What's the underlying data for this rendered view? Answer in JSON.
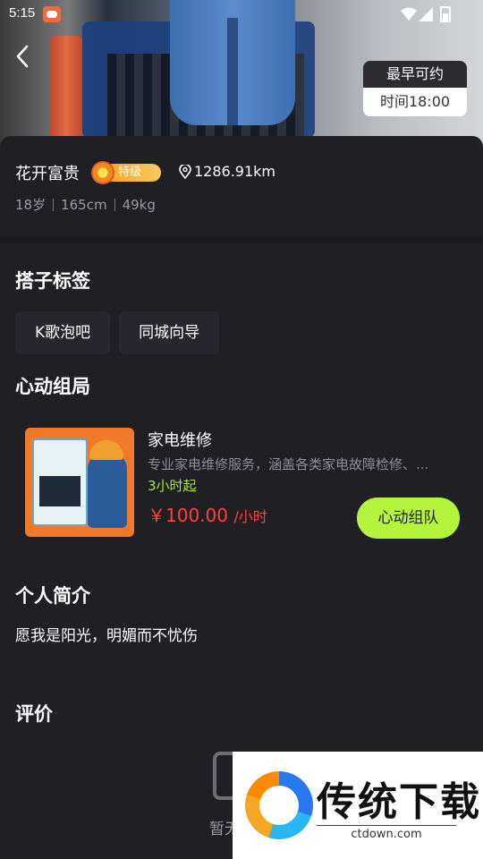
{
  "status_bar": {
    "time": "5:15"
  },
  "availability": {
    "label": "最早可约",
    "time": "时间18:00"
  },
  "profile": {
    "name": "花开富贵",
    "badge": "特级",
    "distance": "1286.91km",
    "age": "18岁",
    "height": "165cm",
    "weight": "49kg"
  },
  "sections": {
    "tags_title": "搭子标签",
    "group_title": "心动组局",
    "intro_title": "个人简介",
    "reviews_title": "评价"
  },
  "tags": [
    "K歌泡吧",
    "同城向导"
  ],
  "service": {
    "title": "家电维修",
    "description": "专业家电维修服务，涵盖各类家电故障检修、...",
    "min_time": "3小时起",
    "price": "￥100.00",
    "unit": "/小时",
    "button": "心动组队"
  },
  "intro": {
    "text": "愿我是阳光，明媚而不忧伤"
  },
  "reviews": {
    "empty_text": "暂无"
  },
  "watermark": {
    "brand": "传统下载",
    "domain": "ctdown.com"
  },
  "colors": {
    "background": "#1f1f24",
    "accent_green": "#b4f43c",
    "price_red": "#ff4040",
    "min_time_green": "#a8e63a"
  }
}
